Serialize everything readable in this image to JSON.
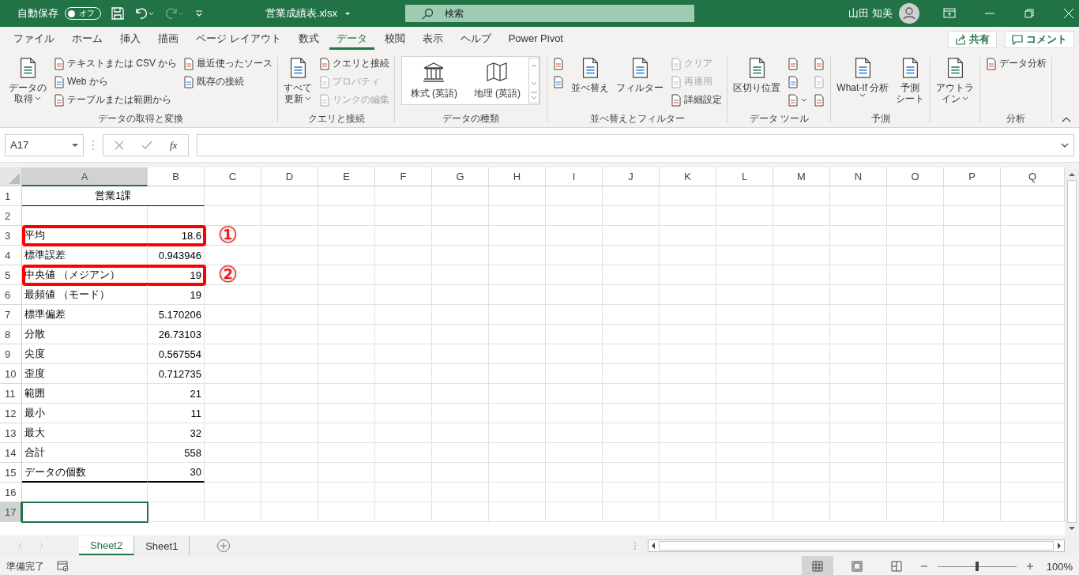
{
  "title_bar": {
    "autosave_label": "自動保存",
    "autosave": {
      "on": false,
      "text": "オフ"
    },
    "filename": "営業成績表.xlsx",
    "search_placeholder": "検索",
    "user": "山田 知美"
  },
  "menu_tabs": [
    {
      "label": "ファイル",
      "selected": false
    },
    {
      "label": "ホーム",
      "selected": false
    },
    {
      "label": "挿入",
      "selected": false
    },
    {
      "label": "描画",
      "selected": false
    },
    {
      "label": "ページ レイアウト",
      "selected": false
    },
    {
      "label": "数式",
      "selected": false
    },
    {
      "label": "データ",
      "selected": true
    },
    {
      "label": "校閲",
      "selected": false
    },
    {
      "label": "表示",
      "selected": false
    },
    {
      "label": "ヘルプ",
      "selected": false
    },
    {
      "label": "Power Pivot",
      "selected": false
    }
  ],
  "share_button": "共有",
  "comment_button": "コメント",
  "ribbon_groups": [
    {
      "label": "データの取得と変換",
      "columns": [
        {
          "kind": "large",
          "items": [
            {
              "lines": [
                "データの",
                "取得"
              ],
              "dropdown": true,
              "disabled": false
            }
          ]
        },
        {
          "kind": "stack",
          "items": [
            {
              "label": "テキストまたは CSV から",
              "dropdown": false,
              "disabled": false
            },
            {
              "label": "Web から",
              "dropdown": false,
              "disabled": false
            },
            {
              "label": "テーブルまたは範囲から",
              "dropdown": false,
              "disabled": false
            }
          ]
        },
        {
          "kind": "stack",
          "items": [
            {
              "label": "最近使ったソース",
              "dropdown": false,
              "disabled": false
            },
            {
              "label": "既存の接続",
              "dropdown": false,
              "disabled": false
            }
          ]
        }
      ]
    },
    {
      "label": "クエリと接続",
      "columns": [
        {
          "kind": "large",
          "items": [
            {
              "lines": [
                "すべて",
                "更新"
              ],
              "dropdown": true,
              "disabled": false
            }
          ]
        },
        {
          "kind": "stack",
          "items": [
            {
              "label": "クエリと接続",
              "dropdown": false,
              "disabled": false
            },
            {
              "label": "プロパティ",
              "dropdown": false,
              "disabled": true
            },
            {
              "label": "リンクの編集",
              "dropdown": false,
              "disabled": true
            }
          ]
        }
      ]
    },
    {
      "label": "データの種類",
      "columns": [
        {
          "kind": "gallery",
          "items": [
            {
              "label": "株式 (英語)",
              "disabled": false
            },
            {
              "label": "地理 (英語)",
              "disabled": false
            }
          ]
        }
      ]
    },
    {
      "label": "並べ替えとフィルター",
      "columns": [
        {
          "kind": "stack",
          "items": [
            {
              "dropdown": false,
              "disabled": false
            },
            {
              "dropdown": false,
              "disabled": false
            }
          ]
        },
        {
          "kind": "large",
          "items": [
            {
              "lines": [
                "並べ替え"
              ],
              "dropdown": false,
              "disabled": false
            }
          ]
        },
        {
          "kind": "large",
          "items": [
            {
              "lines": [
                "フィルター"
              ],
              "dropdown": false,
              "disabled": false
            }
          ]
        },
        {
          "kind": "stack",
          "items": [
            {
              "label": "クリア",
              "dropdown": false,
              "disabled": true
            },
            {
              "label": "再適用",
              "dropdown": false,
              "disabled": true
            },
            {
              "label": "詳細設定",
              "dropdown": false,
              "disabled": false
            }
          ]
        }
      ]
    },
    {
      "label": "データ ツール",
      "columns": [
        {
          "kind": "large",
          "items": [
            {
              "lines": [
                "区切り位置"
              ],
              "dropdown": false,
              "disabled": false
            }
          ]
        },
        {
          "kind": "stack",
          "items": [
            {
              "dropdown": false,
              "disabled": false
            },
            {
              "dropdown": false,
              "disabled": false
            },
            {
              "dropdown": true,
              "disabled": false
            }
          ]
        },
        {
          "kind": "stack",
          "items": [
            {
              "dropdown": false,
              "disabled": false
            },
            {
              "dropdown": false,
              "disabled": true
            },
            {
              "dropdown": false,
              "disabled": false
            }
          ]
        }
      ]
    },
    {
      "label": "予測",
      "columns": [
        {
          "kind": "large",
          "items": [
            {
              "lines": [
                "What-If 分析"
              ],
              "dropdown": true,
              "disabled": false
            }
          ]
        },
        {
          "kind": "large",
          "items": [
            {
              "lines": [
                "予測",
                "シート"
              ],
              "dropdown": false,
              "disabled": false
            }
          ]
        }
      ]
    },
    {
      "columns": [
        {
          "kind": "large",
          "items": [
            {
              "lines": [
                "アウトラ",
                "イン"
              ],
              "dropdown": true,
              "disabled": false
            }
          ]
        }
      ]
    },
    {
      "label": "分析",
      "columns": [
        {
          "kind": "stack",
          "items": [
            {
              "label": "データ分析",
              "dropdown": false,
              "disabled": false
            }
          ]
        }
      ]
    }
  ],
  "formula_bar": {
    "name_box": "A17",
    "function_label": "fx"
  },
  "columns": [
    {
      "label": "A",
      "selected": true
    },
    {
      "label": "B",
      "selected": false
    },
    {
      "label": "C",
      "selected": false
    },
    {
      "label": "D",
      "selected": false
    },
    {
      "label": "E",
      "selected": false
    },
    {
      "label": "F",
      "selected": false
    },
    {
      "label": "G",
      "selected": false
    },
    {
      "label": "H",
      "selected": false
    },
    {
      "label": "I",
      "selected": false
    },
    {
      "label": "J",
      "selected": false
    },
    {
      "label": "K",
      "selected": false
    },
    {
      "label": "L",
      "selected": false
    },
    {
      "label": "M",
      "selected": false
    },
    {
      "label": "N",
      "selected": false
    },
    {
      "label": "O",
      "selected": false
    },
    {
      "label": "P",
      "selected": false
    },
    {
      "label": "Q",
      "selected": false
    }
  ],
  "rows": [
    {
      "number": "1",
      "selected": false,
      "kind": "title",
      "cells": [
        "営業1課"
      ]
    },
    {
      "number": "2",
      "selected": false,
      "kind": "blank",
      "cells": []
    },
    {
      "number": "3",
      "selected": false,
      "kind": "data",
      "callout": "①",
      "cells": [
        "平均",
        "18.6"
      ]
    },
    {
      "number": "4",
      "selected": false,
      "kind": "data",
      "cells": [
        "標準誤差",
        "0.943946"
      ]
    },
    {
      "number": "5",
      "selected": false,
      "kind": "data",
      "callout": "②",
      "cells": [
        "中央値 （メジアン）",
        "19"
      ]
    },
    {
      "number": "6",
      "selected": false,
      "kind": "data",
      "cells": [
        "最頻値 （モード）",
        "19"
      ]
    },
    {
      "number": "7",
      "selected": false,
      "kind": "data",
      "cells": [
        "標準偏差",
        "5.170206"
      ]
    },
    {
      "number": "8",
      "selected": false,
      "kind": "data",
      "cells": [
        "分散",
        "26.73103"
      ]
    },
    {
      "number": "9",
      "selected": false,
      "kind": "data",
      "cells": [
        "尖度",
        "0.567554"
      ]
    },
    {
      "number": "10",
      "selected": false,
      "kind": "data",
      "cells": [
        "歪度",
        "0.712735"
      ]
    },
    {
      "number": "11",
      "selected": false,
      "kind": "data",
      "cells": [
        "範囲",
        "21"
      ]
    },
    {
      "number": "12",
      "selected": false,
      "kind": "data",
      "cells": [
        "最小",
        "11"
      ]
    },
    {
      "number": "13",
      "selected": false,
      "kind": "data",
      "cells": [
        "最大",
        "32"
      ]
    },
    {
      "number": "14",
      "selected": false,
      "kind": "data",
      "cells": [
        "合計",
        "558"
      ]
    },
    {
      "number": "15",
      "selected": false,
      "kind": "last",
      "cells": [
        "データの個数",
        "30"
      ]
    },
    {
      "number": "16",
      "selected": false,
      "kind": "blank",
      "cells": []
    },
    {
      "number": "17",
      "selected": true,
      "kind": "active",
      "cells": []
    }
  ],
  "sheet_tabs": [
    {
      "label": "Sheet2",
      "selected": true
    },
    {
      "label": "Sheet1",
      "selected": false
    }
  ],
  "status_bar": {
    "status": "準備完了",
    "views": [
      {
        "selected": true
      },
      {
        "selected": false
      },
      {
        "selected": false
      }
    ],
    "zoom": {
      "level": 0.5,
      "text": "100%"
    }
  }
}
